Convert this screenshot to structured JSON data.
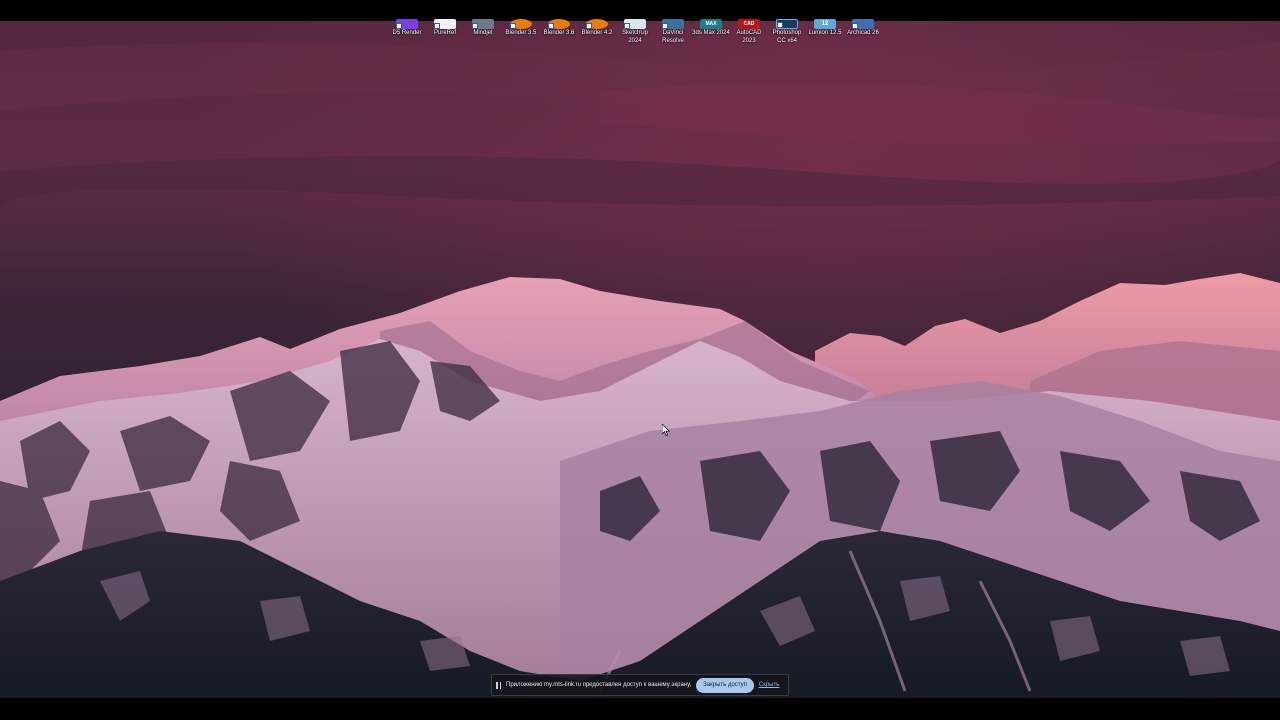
{
  "desktop": {
    "icons": [
      {
        "label": "D5 Render",
        "icon": "d5-render-icon",
        "color": "#7b3fe4"
      },
      {
        "label": "PureRef",
        "icon": "pureref-icon",
        "color": "#f2f2f2"
      },
      {
        "label": "Mindjet",
        "icon": "mindjet-icon",
        "color": "#6c7a8a"
      },
      {
        "label": "Blender 3.5",
        "icon": "blender-icon",
        "color": "#e87d0d"
      },
      {
        "label": "Blender 3.6",
        "icon": "blender-icon",
        "color": "#e87d0d"
      },
      {
        "label": "Blender 4.2",
        "icon": "blender-icon",
        "color": "#e87d0d"
      },
      {
        "label": "SketchUp 2024",
        "icon": "sketchup-icon",
        "color": "#d8e6f2"
      },
      {
        "label": "DaVinci Resolve",
        "icon": "davinci-resolve-icon",
        "color": "#3b6f9e"
      },
      {
        "label": "3ds Max 2024",
        "icon": "3ds-max-icon",
        "color": "#1a7d8c",
        "badge": "MAX"
      },
      {
        "label": "AutoCAD 2023",
        "icon": "autocad-icon",
        "color": "#b5161b",
        "badge": "CAD"
      },
      {
        "label": "Photoshop CC x64",
        "icon": "photoshop-icon",
        "color": "#1c3b5c"
      },
      {
        "label": "Lumion 12.5",
        "icon": "lumion-icon",
        "color": "#5da9d6",
        "badge": "12"
      },
      {
        "label": "Archicad 26",
        "icon": "archicad-icon",
        "color": "#3d6fb5"
      }
    ]
  },
  "share_bar": {
    "message": "Приложению my.mts-link.ru предоставлен доступ к вашему экрану.",
    "close_label": "Закрыть доступ",
    "hide_label": "Скрыть"
  },
  "colors": {
    "sky_top": "#4e2940",
    "sky_mid": "#5c2a44",
    "snow_lit": "#e89aa8",
    "snow_shadow": "#8e5d80",
    "rock": "#1c2230"
  }
}
